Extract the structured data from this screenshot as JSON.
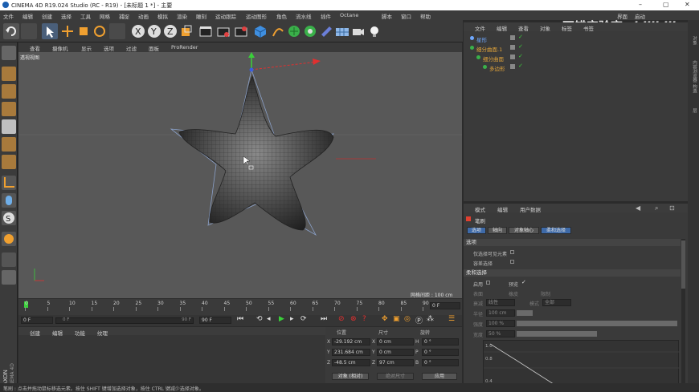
{
  "window": {
    "title": "CINEMA 4D R19.024 Studio (RC - R19) - [未标题 1 *] - 主要",
    "minimize": "–",
    "maximize": "▢",
    "close": "✕",
    "layout_label": "界面",
    "layout_value": "启动"
  },
  "watermark": {
    "text": "不错实验室",
    "brand": "bilibili"
  },
  "menubar": [
    "文件",
    "编辑",
    "创建",
    "选择",
    "工具",
    "网格",
    "捕捉",
    "动画",
    "模拟",
    "渲染",
    "雕刻",
    "运动跟踪",
    "运动图形",
    "角色",
    "流水线",
    "插件",
    "Octane",
    "脚本",
    "窗口",
    "帮助"
  ],
  "viewport": {
    "menu": [
      "查看",
      "摄像机",
      "显示",
      "选项",
      "过滤",
      "面板",
      "ProRender"
    ],
    "label": "透视视图",
    "grid_spacing": "网格间距 : 100 cm"
  },
  "timeline": {
    "ticks": [
      "0",
      "5",
      "10",
      "15",
      "20",
      "25",
      "30",
      "35",
      "40",
      "45",
      "50",
      "55",
      "60",
      "65",
      "70",
      "75",
      "80",
      "85",
      "90"
    ],
    "current_frame": "0 F",
    "start_frame": "0 F",
    "range_start": "0 F",
    "range_end": "90 F",
    "end_frame": "90 F"
  },
  "material_panel": {
    "menu": [
      "创建",
      "编辑",
      "功能",
      "纹理"
    ]
  },
  "coordinates": {
    "headers": {
      "position": "位置",
      "size": "尺寸",
      "rotation": "旋转"
    },
    "rows": [
      {
        "axis": "X",
        "pos": "-29.192 cm",
        "size_axis": "X",
        "size": "0 cm",
        "rot_axis": "H",
        "rot": "0 °"
      },
      {
        "axis": "Y",
        "pos": "231.684 cm",
        "size_axis": "Y",
        "size": "0 cm",
        "rot_axis": "P",
        "rot": "0 °"
      },
      {
        "axis": "Z",
        "pos": "-48.5 cm",
        "size_axis": "Z",
        "size": "97 cm",
        "rot_axis": "B",
        "rot": "0 °"
      }
    ],
    "mode_select": "对象 (相对)",
    "size_select": "绝对尺寸",
    "apply": "应用"
  },
  "object_manager": {
    "menu": [
      "文件",
      "编辑",
      "查看",
      "对象",
      "标签",
      "书签"
    ],
    "objects": [
      {
        "name": "星形",
        "color": "#6fa8ff",
        "indent": 0
      },
      {
        "name": "细分曲面.1",
        "color": "#e2a43a",
        "indent": 0
      },
      {
        "name": "细分曲面",
        "color": "#e2a43a",
        "indent": 1
      },
      {
        "name": "多边形",
        "color": "#e2a43a",
        "indent": 2
      }
    ]
  },
  "attribute_manager": {
    "menu": [
      "模式",
      "编辑",
      "用户数据"
    ],
    "title": "笔刷",
    "tabs": [
      "选项",
      "轴向",
      "对象轴心",
      "柔和选择"
    ],
    "section_options": "选项",
    "opt_visible_only": "仅选择可见元素",
    "opt_tolerance": "容差选择",
    "section_soft": "柔和选择",
    "enable": "启用",
    "preview": "预览",
    "surface": "表面",
    "rubber": "橡皮",
    "limit": "限制",
    "mode_label": "衰减",
    "mode_value": "线性",
    "type_label": "模式",
    "type_value": "全部",
    "radius_label": "半径",
    "radius_value": "100 cm",
    "strength_label": "强度",
    "strength_value": "100 %",
    "width_label": "宽度",
    "width_value": "50 %",
    "graph_labels": [
      "1.0",
      "0.8",
      "0.4"
    ]
  },
  "right_strip": [
    "对象",
    "内容浏览器",
    "构造",
    "层"
  ],
  "statusbar": {
    "text": "笔刷 : 点击并拖动鼠标移选元素。按住 SHIFT 键增加选择对象，按住 CTRL 键减少选择对象。"
  },
  "branding": {
    "maxon": "MAXON",
    "product": "CINEMA 4D"
  }
}
